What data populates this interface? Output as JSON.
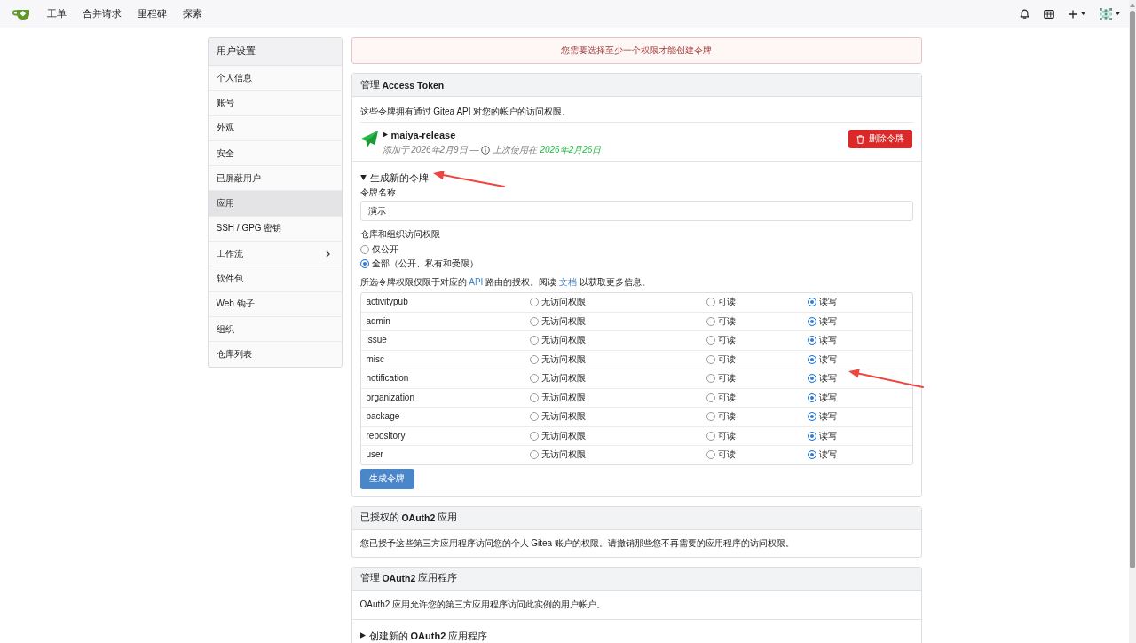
{
  "nav": {
    "items": [
      "工单",
      "合并请求",
      "里程碑",
      "探索"
    ]
  },
  "sidebar": {
    "title": "用户设置",
    "items": [
      {
        "label": "个人信息",
        "selected": false,
        "submenu": false
      },
      {
        "label": "账号",
        "selected": false,
        "submenu": false
      },
      {
        "label": "外观",
        "selected": false,
        "submenu": false
      },
      {
        "label": "安全",
        "selected": false,
        "submenu": false
      },
      {
        "label": "已屏蔽用户",
        "selected": false,
        "submenu": false
      },
      {
        "label": "应用",
        "selected": true,
        "submenu": false
      },
      {
        "label": "SSH / GPG 密钥",
        "selected": false,
        "submenu": false
      },
      {
        "label": "工作流",
        "selected": false,
        "submenu": true
      },
      {
        "label": "软件包",
        "selected": false,
        "submenu": false
      },
      {
        "label": "Web 钩子",
        "selected": false,
        "submenu": false
      },
      {
        "label": "组织",
        "selected": false,
        "submenu": false
      },
      {
        "label": "仓库列表",
        "selected": false,
        "submenu": false
      }
    ]
  },
  "alert": {
    "message": "您需要选择至少一个权限才能创建令牌"
  },
  "access_tokens": {
    "title": "管理 **Access Token**",
    "description": "这些令牌拥有通过 Gitea API 对您的帐户的访问权限。",
    "tokens": [
      {
        "name": "maiya-release",
        "expanded": false,
        "added": "添加于 2026年2月9日 —",
        "last_used_label": "上次使用在",
        "last_used": "2026年2月26日",
        "delete_button": "删除令牌"
      }
    ],
    "new_token": {
      "heading": "生成新的令牌",
      "expanded": true,
      "arrow": true,
      "name_label": "令牌名称",
      "name_value": "演示",
      "access_label": "仓库和组织访问权限",
      "access_options": [
        {
          "label": "仅公开",
          "selected": false
        },
        {
          "label": "全部（公开、私有和受限）",
          "selected": true
        }
      ],
      "scope_note": [
        {
          "kind": "text",
          "text": "所选令牌权限仅限于对应的 "
        },
        {
          "kind": "link",
          "text": "API"
        },
        {
          "kind": "text",
          "text": " 路由的授权。阅读 "
        },
        {
          "kind": "link",
          "text": "文档"
        },
        {
          "kind": "text",
          "text": " 以获取更多信息。"
        }
      ],
      "permissions": {
        "arrow": true,
        "rows": [
          {
            "name": "activitypub",
            "options": [
              {
                "label": "无访问权限",
                "selected": false
              },
              {
                "label": "可读",
                "selected": false
              },
              {
                "label": "读写",
                "selected": true
              }
            ]
          },
          {
            "name": "admin",
            "options": [
              {
                "label": "无访问权限",
                "selected": false
              },
              {
                "label": "可读",
                "selected": false
              },
              {
                "label": "读写",
                "selected": true
              }
            ]
          },
          {
            "name": "issue",
            "options": [
              {
                "label": "无访问权限",
                "selected": false
              },
              {
                "label": "可读",
                "selected": false
              },
              {
                "label": "读写",
                "selected": true
              }
            ]
          },
          {
            "name": "misc",
            "options": [
              {
                "label": "无访问权限",
                "selected": false
              },
              {
                "label": "可读",
                "selected": false
              },
              {
                "label": "读写",
                "selected": true
              }
            ]
          },
          {
            "name": "notification",
            "options": [
              {
                "label": "无访问权限",
                "selected": false
              },
              {
                "label": "可读",
                "selected": false
              },
              {
                "label": "读写",
                "selected": true
              }
            ]
          },
          {
            "name": "organization",
            "options": [
              {
                "label": "无访问权限",
                "selected": false
              },
              {
                "label": "可读",
                "selected": false
              },
              {
                "label": "读写",
                "selected": true
              }
            ]
          },
          {
            "name": "package",
            "options": [
              {
                "label": "无访问权限",
                "selected": false
              },
              {
                "label": "可读",
                "selected": false
              },
              {
                "label": "读写",
                "selected": true
              }
            ]
          },
          {
            "name": "repository",
            "options": [
              {
                "label": "无访问权限",
                "selected": false
              },
              {
                "label": "可读",
                "selected": false
              },
              {
                "label": "读写",
                "selected": true
              }
            ]
          },
          {
            "name": "user",
            "options": [
              {
                "label": "无访问权限",
                "selected": false
              },
              {
                "label": "可读",
                "selected": false
              },
              {
                "label": "读写",
                "selected": true
              }
            ]
          }
        ]
      },
      "submit_button": "生成令牌"
    }
  },
  "authorized_oauth2": {
    "title": "已授权的 **OAuth2** 应用",
    "description": "您已授予这些第三方应用程序访问您的个人 Gitea 账户的权限。请撤销那些您不再需要的应用程序的访问权限。"
  },
  "oauth2_apps": {
    "title": "管理 **OAuth2** 应用程序",
    "description": "OAuth2 应用允许您的第三方应用程序访问此实例的用户帐户。",
    "create": {
      "label": "创建新的 **OAuth2** 应用程序",
      "expanded": false
    }
  }
}
